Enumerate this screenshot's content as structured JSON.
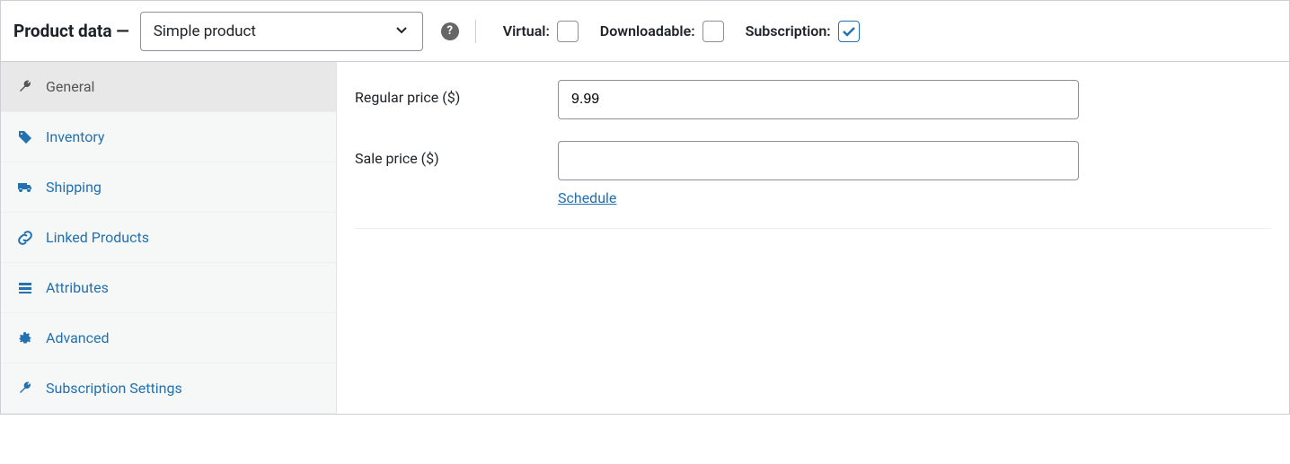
{
  "header": {
    "title": "Product data —",
    "product_type_selected": "Simple product",
    "checkboxes": {
      "virtual_label": "Virtual:",
      "virtual_checked": false,
      "downloadable_label": "Downloadable:",
      "downloadable_checked": false,
      "subscription_label": "Subscription:",
      "subscription_checked": true
    }
  },
  "sidebar": {
    "items": [
      {
        "label": "General",
        "icon": "wrench-icon",
        "active": true
      },
      {
        "label": "Inventory",
        "icon": "tag-icon",
        "active": false
      },
      {
        "label": "Shipping",
        "icon": "truck-icon",
        "active": false
      },
      {
        "label": "Linked Products",
        "icon": "link-icon",
        "active": false
      },
      {
        "label": "Attributes",
        "icon": "list-icon",
        "active": false
      },
      {
        "label": "Advanced",
        "icon": "gear-icon",
        "active": false
      },
      {
        "label": "Subscription Settings",
        "icon": "wrench-icon",
        "active": false
      }
    ]
  },
  "form": {
    "regular_price_label": "Regular price ($)",
    "regular_price_value": "9.99",
    "sale_price_label": "Sale price ($)",
    "sale_price_value": "",
    "schedule_link": "Schedule"
  }
}
